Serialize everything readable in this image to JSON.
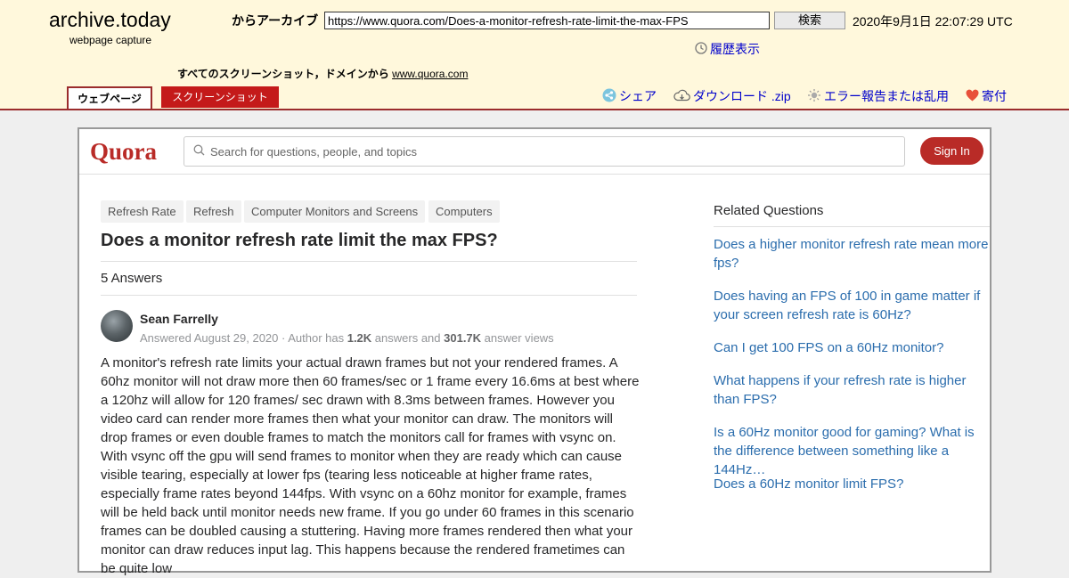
{
  "archive": {
    "logo_title": "archive.today",
    "logo_subtitle": "webpage capture",
    "archive_label": "からアーカイブ",
    "url_value": "https://www.quora.com/Does-a-monitor-refresh-rate-limit-the-max-FPS",
    "search_button": "検索",
    "capture_date": "2020年9月1日 22:07:29 UTC",
    "history_link": "履歴表示",
    "all_screenshots_text": "すべてのスクリーンショット，ドメインから",
    "domain_link": "www.quora.com",
    "tab_webpage": "ウェブページ",
    "tab_screenshot": "スクリーンショット",
    "share_link": "シェア",
    "download_link": "ダウンロード .zip",
    "report_link": "エラー報告または乱用",
    "donate_link": "寄付",
    "colors": {
      "header_bg": "#fff8dc",
      "accent_red": "#c41a1a",
      "link_blue": "#0000cc"
    }
  },
  "quora": {
    "logo": "Quora",
    "search_placeholder": "Search for questions, people, and topics",
    "sign_in": "Sign In",
    "topics": [
      "Refresh Rate",
      "Refresh",
      "Computer Monitors and Screens",
      "Computers"
    ],
    "question_title": "Does a monitor refresh rate limit the max FPS?",
    "answer_count": "5 Answers",
    "answer": {
      "author": "Sean Farrelly",
      "meta_prefix": "Answered August 29, 2020 · Author has ",
      "answers_count": "1.2K",
      "meta_middle": " answers and ",
      "views_count": "301.7K",
      "meta_suffix": " answer views",
      "text": "A monitor's refresh rate limits your actual drawn frames but not your rendered frames. A 60hz monitor will not draw more then 60 frames/sec or 1 frame every 16.6ms at best where a 120hz will allow for 120 frames/ sec drawn with 8.3ms between frames. However you video card can render more frames then what your monitor can draw. The monitors will drop frames or even double frames to match the monitors call for frames with vsync on. With vsync off the gpu will send frames to monitor when they are ready which can cause visible tearing, especially at lower fps (tearing less noticeable at higher frame rates, especially frame rates beyond 144fps. With vsync on a 60hz monitor for example, frames will be held back until monitor needs new frame. If you go under 60 frames in this scenario frames can be doubled causing a stuttering. Having more frames rendered then what your monitor can draw reduces input lag. This happens because the rendered frametimes can be quite low"
    },
    "related_title": "Related Questions",
    "related": [
      "Does a higher monitor refresh rate mean more fps?",
      "Does having an FPS of 100 in game matter if your screen refresh rate is 60Hz?",
      "Can I get 100 FPS on a 60Hz monitor?",
      "What happens if your refresh rate is higher than FPS?",
      "Is a 60Hz monitor good for gaming? What is the difference between something like a 144Hz…",
      "Does a 60Hz monitor limit FPS?"
    ],
    "colors": {
      "brand_red": "#b92b27",
      "related_link": "#2b6dad"
    }
  }
}
